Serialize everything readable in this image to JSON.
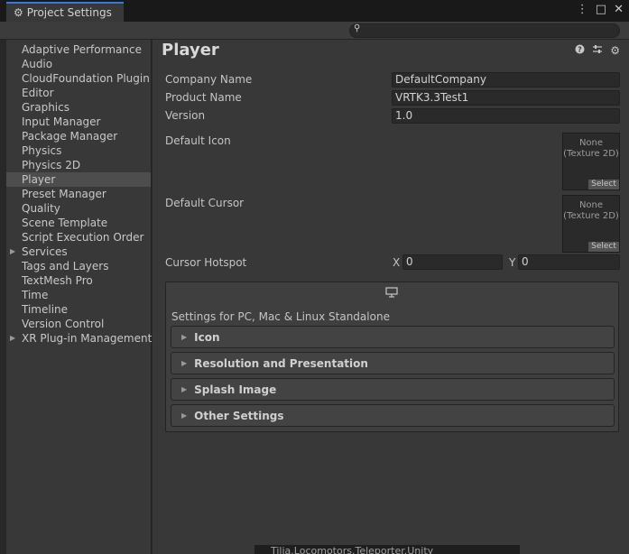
{
  "window": {
    "tab_title": "Project Settings",
    "menu_icon": "⋮",
    "maximize_icon": "□",
    "close_icon": "✕"
  },
  "sidebar": {
    "items": [
      {
        "label": "Adaptive Performance",
        "expandable": false,
        "selected": false
      },
      {
        "label": "Audio",
        "expandable": false,
        "selected": false
      },
      {
        "label": "CloudFoundation Plugin",
        "expandable": false,
        "selected": false
      },
      {
        "label": "Editor",
        "expandable": false,
        "selected": false
      },
      {
        "label": "Graphics",
        "expandable": false,
        "selected": false
      },
      {
        "label": "Input Manager",
        "expandable": false,
        "selected": false
      },
      {
        "label": "Package Manager",
        "expandable": false,
        "selected": false
      },
      {
        "label": "Physics",
        "expandable": false,
        "selected": false
      },
      {
        "label": "Physics 2D",
        "expandable": false,
        "selected": false
      },
      {
        "label": "Player",
        "expandable": false,
        "selected": true
      },
      {
        "label": "Preset Manager",
        "expandable": false,
        "selected": false
      },
      {
        "label": "Quality",
        "expandable": false,
        "selected": false
      },
      {
        "label": "Scene Template",
        "expandable": false,
        "selected": false
      },
      {
        "label": "Script Execution Order",
        "expandable": false,
        "selected": false
      },
      {
        "label": "Services",
        "expandable": true,
        "selected": false
      },
      {
        "label": "Tags and Layers",
        "expandable": false,
        "selected": false
      },
      {
        "label": "TextMesh Pro",
        "expandable": false,
        "selected": false
      },
      {
        "label": "Time",
        "expandable": false,
        "selected": false
      },
      {
        "label": "Timeline",
        "expandable": false,
        "selected": false
      },
      {
        "label": "Version Control",
        "expandable": false,
        "selected": false
      },
      {
        "label": "XR Plug-in Management",
        "expandable": true,
        "selected": false
      }
    ]
  },
  "main": {
    "title": "Player",
    "company_name": {
      "label": "Company Name",
      "value": "DefaultCompany"
    },
    "product_name": {
      "label": "Product Name",
      "value": "VRTK3.3Test1"
    },
    "version": {
      "label": "Version",
      "value": "1.0"
    },
    "default_icon": {
      "label": "Default Icon",
      "line1": "None",
      "line2": "(Texture 2D)",
      "select": "Select"
    },
    "default_cursor": {
      "label": "Default Cursor",
      "line1": "None",
      "line2": "(Texture 2D)",
      "select": "Select"
    },
    "cursor_hotspot": {
      "label": "Cursor Hotspot",
      "x_label": "X",
      "x_value": "0",
      "y_label": "Y",
      "y_value": "0"
    },
    "platform_label": "Settings for PC, Mac & Linux Standalone",
    "sections": [
      "Icon",
      "Resolution and Presentation",
      "Splash Image",
      "Other Settings"
    ]
  },
  "background_window": {
    "title": "Tilia.Locomotors.Teleporter.Unity"
  },
  "colors": {
    "accent": "#3a7bd5",
    "panel": "#383838",
    "field": "#2a2a2a",
    "selected": "#4d4d4d"
  }
}
